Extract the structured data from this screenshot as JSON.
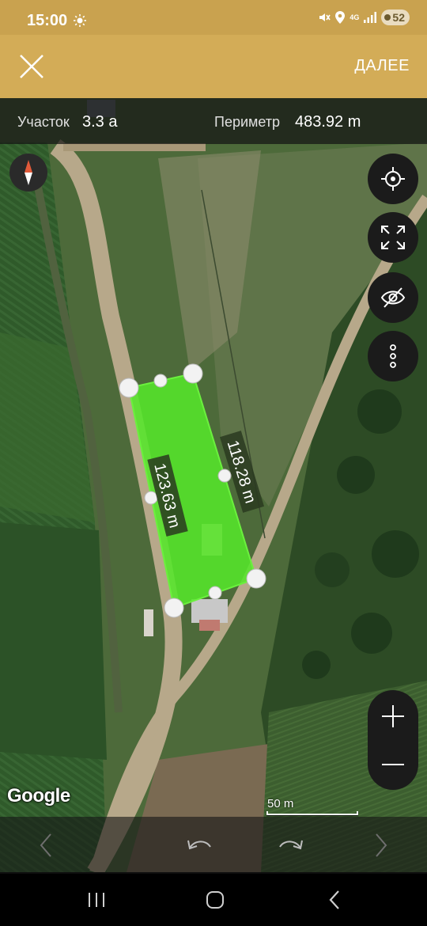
{
  "status_bar": {
    "time": "15:00",
    "network_label": "4G",
    "battery": "52"
  },
  "toolbar": {
    "next_label": "ДАЛЕЕ"
  },
  "stats": {
    "area_label": "Участок",
    "area_value": "3.3 а",
    "perimeter_label": "Периметр",
    "perimeter_value": "483.92 m"
  },
  "polygon": {
    "edge_left_label": "123.63 m",
    "edge_right_label": "118.28 m",
    "fill_color": "#55e62a"
  },
  "map": {
    "attribution": "Google",
    "scale_label": "50 m"
  },
  "colors": {
    "accent": "#d3ac57",
    "status_bar": "#c9a24f"
  }
}
